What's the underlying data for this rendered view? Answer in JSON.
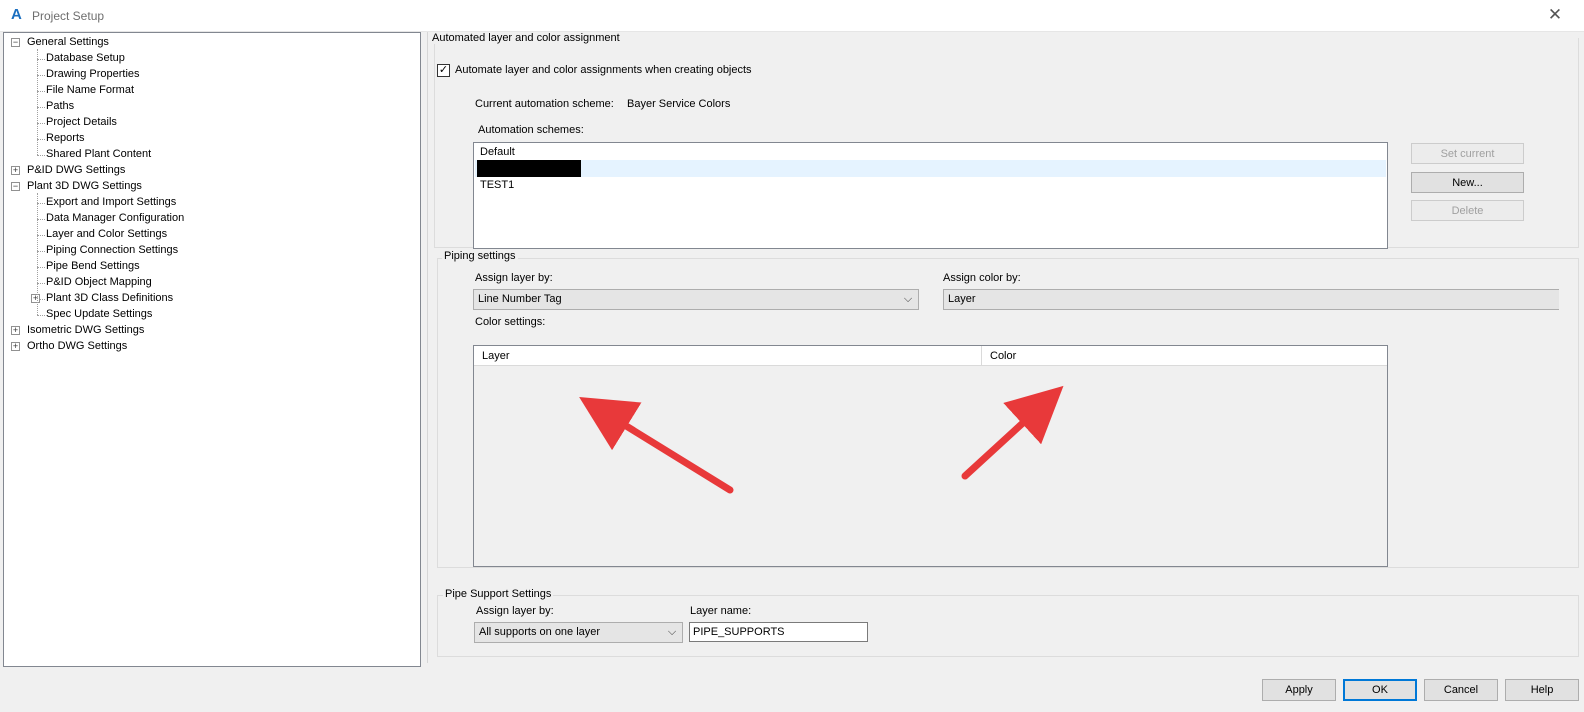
{
  "window": {
    "title": "Project Setup"
  },
  "tree": [
    {
      "label": "General Settings",
      "level": 0,
      "expander": "−"
    },
    {
      "label": "Database Setup",
      "level": 1,
      "expander": ""
    },
    {
      "label": "Drawing Properties",
      "level": 1,
      "expander": ""
    },
    {
      "label": "File Name Format",
      "level": 1,
      "expander": ""
    },
    {
      "label": "Paths",
      "level": 1,
      "expander": ""
    },
    {
      "label": "Project Details",
      "level": 1,
      "expander": ""
    },
    {
      "label": "Reports",
      "level": 1,
      "expander": ""
    },
    {
      "label": "Shared Plant Content",
      "level": 1,
      "expander": ""
    },
    {
      "label": "P&ID DWG Settings",
      "level": 0,
      "expander": "+"
    },
    {
      "label": "Plant 3D DWG Settings",
      "level": 0,
      "expander": "−"
    },
    {
      "label": "Export and Import Settings",
      "level": 1,
      "expander": ""
    },
    {
      "label": "Data Manager Configuration",
      "level": 1,
      "expander": ""
    },
    {
      "label": "Layer and Color Settings",
      "level": 1,
      "expander": ""
    },
    {
      "label": "Piping Connection Settings",
      "level": 1,
      "expander": ""
    },
    {
      "label": "Pipe Bend Settings",
      "level": 1,
      "expander": ""
    },
    {
      "label": "P&ID Object Mapping",
      "level": 1,
      "expander": ""
    },
    {
      "label": "Plant 3D Class Definitions",
      "level": 1,
      "expander": "+"
    },
    {
      "label": "Spec Update Settings",
      "level": 1,
      "expander": ""
    },
    {
      "label": "Isometric DWG Settings",
      "level": 0,
      "expander": "+"
    },
    {
      "label": "Ortho DWG Settings",
      "level": 0,
      "expander": "+"
    }
  ],
  "automation": {
    "group_title": "Automated layer and color assignment",
    "checkbox_label": "Automate layer and color assignments when creating objects",
    "checkbox_mark": "✓",
    "current_scheme_label": "Current automation scheme:",
    "current_scheme_value": "Bayer Service Colors",
    "schemes_label": "Automation schemes:",
    "schemes": [
      "Default",
      "",
      "TEST1"
    ],
    "buttons": {
      "set_current": "Set current",
      "new": "New...",
      "delete": "Delete"
    }
  },
  "piping": {
    "group_title": "Piping settings",
    "assign_layer_label": "Assign layer by:",
    "assign_layer_value": "Line Number Tag",
    "assign_color_label": "Assign color by:",
    "assign_color_value": "Layer",
    "color_settings_label": "Color settings:",
    "columns": [
      "Layer",
      "Color"
    ]
  },
  "pipe_support": {
    "group_title": "Pipe Support Settings",
    "assign_layer_label": "Assign layer by:",
    "assign_layer_value": "All supports on one layer",
    "layer_name_label": "Layer name:",
    "layer_name_value": "PIPE_SUPPORTS"
  },
  "footer": {
    "apply": "Apply",
    "ok": "OK",
    "cancel": "Cancel",
    "help": "Help"
  },
  "colors": {
    "arrow": "#e8393a",
    "accent": "#0078d7"
  },
  "icons": {
    "dropdown": "⌵",
    "close": "✕",
    "app": "A"
  }
}
